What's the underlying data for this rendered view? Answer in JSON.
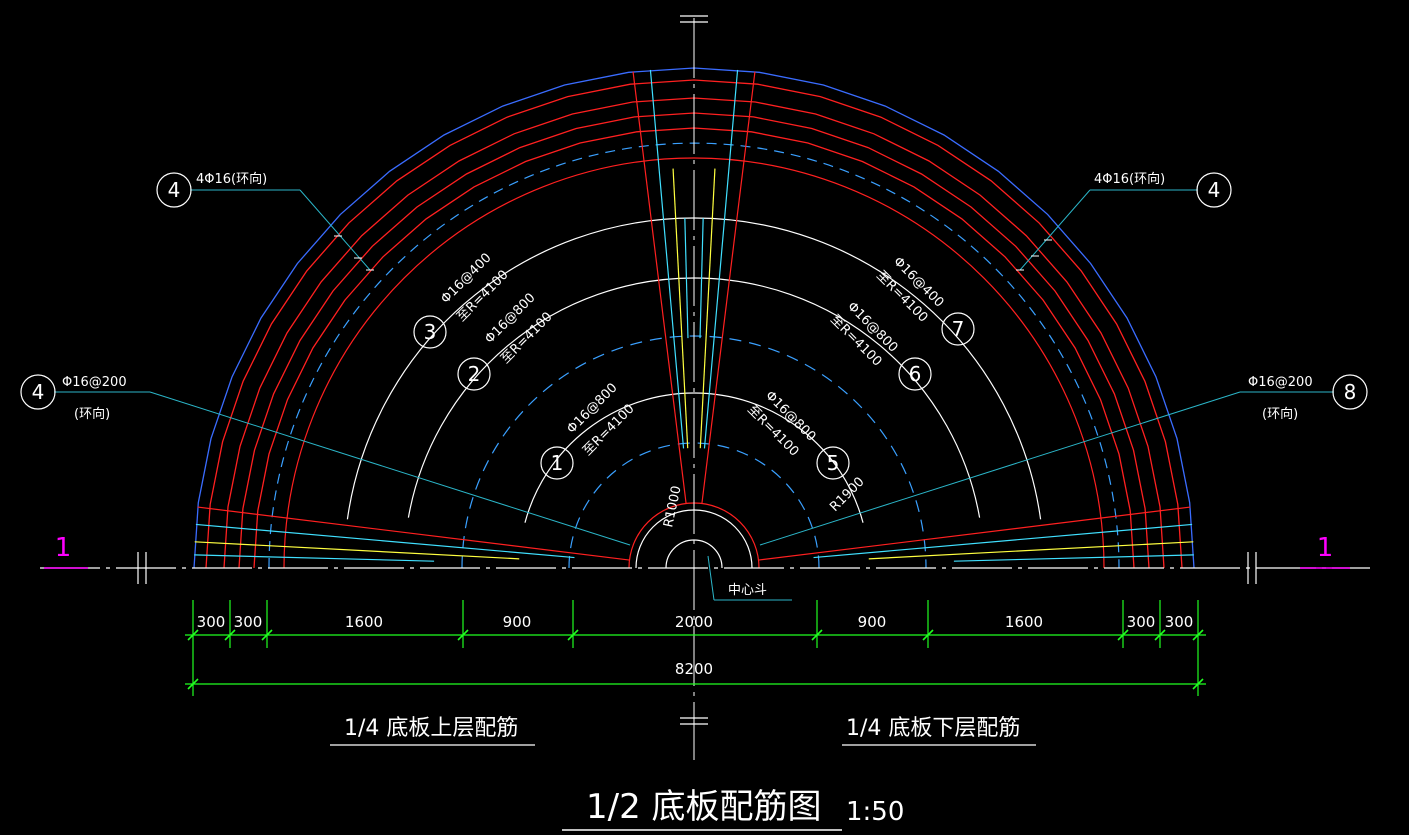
{
  "drawing": {
    "title": "1/2  底板配筋图",
    "scale": "1:50",
    "left_caption": "1/4 底板上层配筋",
    "right_caption": "1/4 底板下层配筋",
    "center_label": "中心斗",
    "section_mark_left": "1",
    "section_mark_right": "1",
    "radius_label_small": "R1000",
    "radius_label_mid": "R1900"
  },
  "dimensions": {
    "segments": [
      "300",
      "300",
      "1600",
      "900",
      "2000",
      "900",
      "1600",
      "300",
      "300"
    ],
    "total": "8200"
  },
  "callouts": [
    {
      "num": "4",
      "text1": "4Φ16(环向)",
      "text2": ""
    },
    {
      "num": "4",
      "text1": "4Φ16(环向)",
      "text2": ""
    },
    {
      "num": "4",
      "text1": "Φ16@200",
      "text2": "(环向)"
    },
    {
      "num": "8",
      "text1": "Φ16@200",
      "text2": "(环向)"
    },
    {
      "num": "3",
      "text1": "Φ16@400",
      "text2": "至R=4100"
    },
    {
      "num": "2",
      "text1": "Φ16@800",
      "text2": "至R=4100"
    },
    {
      "num": "1",
      "text1": "Φ16@800",
      "text2": "至R=4100"
    },
    {
      "num": "7",
      "text1": "Φ16@400",
      "text2": "至R=4100"
    },
    {
      "num": "6",
      "text1": "Φ16@800",
      "text2": "至R=4100"
    },
    {
      "num": "5",
      "text1": "Φ16@800",
      "text2": "至R=4100"
    }
  ],
  "colors": {
    "background": "#000000",
    "outline": "#3a6cff",
    "rebar_red": "#ff2020",
    "rebar_cyan": "#40e0ff",
    "rebar_yellow": "#ffff40",
    "rebar_white": "#ffffff",
    "dashed_blue": "#3aa0ff",
    "dimension": "#20ff20",
    "leader": "#2bb5c8",
    "section_mark": "#ff00ff"
  }
}
